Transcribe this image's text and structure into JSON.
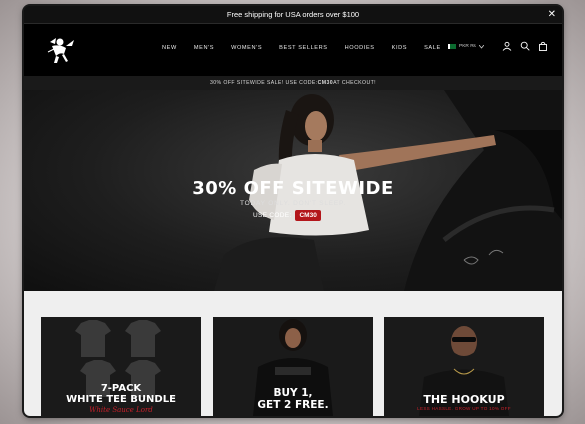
{
  "announcement": {
    "text": "Free shipping for USA orders over $100",
    "close_glyph": "✕"
  },
  "nav": {
    "items": [
      "NEW",
      "MEN'S",
      "WOMEN'S",
      "BEST SELLERS",
      "HOODIES",
      "KIDS",
      "SALE"
    ],
    "locale": "PKR ₨"
  },
  "promo_bar": {
    "text": "30% OFF SITEWIDE SALE! USE CODE: ",
    "code": "CM30",
    "suffix": " AT CHECKOUT!"
  },
  "hero": {
    "title": "30% OFF SITEWIDE",
    "subtitle": "TODAY ONLY. DON'T SLEEP.",
    "code_label": "USE CODE:",
    "code": "CM30"
  },
  "products": [
    {
      "title_line1": "7-PACK",
      "title_line2": "WHITE TEE BUNDLE",
      "script": "White Sauce Lord"
    },
    {
      "title_line1": "BUY 1,",
      "title_line2": "GET 2 FREE."
    },
    {
      "title": "THE HOOKUP",
      "subtitle": "LESS HASSLE. GROW UP TO 10% OFF"
    }
  ],
  "colors": {
    "accent": "#b3161b",
    "background": "#000000",
    "text": "#ffffff"
  }
}
